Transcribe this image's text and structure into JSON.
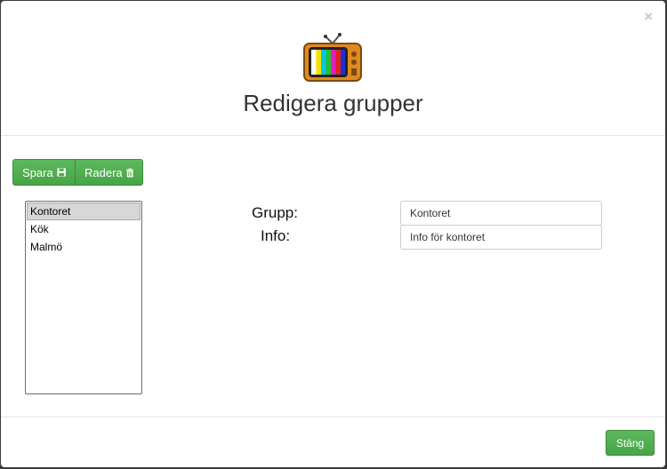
{
  "modal": {
    "close_glyph": "×",
    "title": "Redigera grupper"
  },
  "toolbar": {
    "save_label": "Spara",
    "delete_label": "Radera"
  },
  "group_list": {
    "items": [
      "Kontoret",
      "Kök",
      "Malmö"
    ],
    "selected": "Kontoret"
  },
  "form": {
    "group_label": "Grupp:",
    "info_label": "Info:",
    "group_value": "Kontoret",
    "info_value": "Info för kontoret"
  },
  "footer": {
    "close_label": "Stäng"
  },
  "icons": {
    "save": "floppy-disk-icon",
    "delete": "trash-icon",
    "logo": "tv-icon"
  },
  "colors": {
    "accent_green": "#5cb85c"
  }
}
